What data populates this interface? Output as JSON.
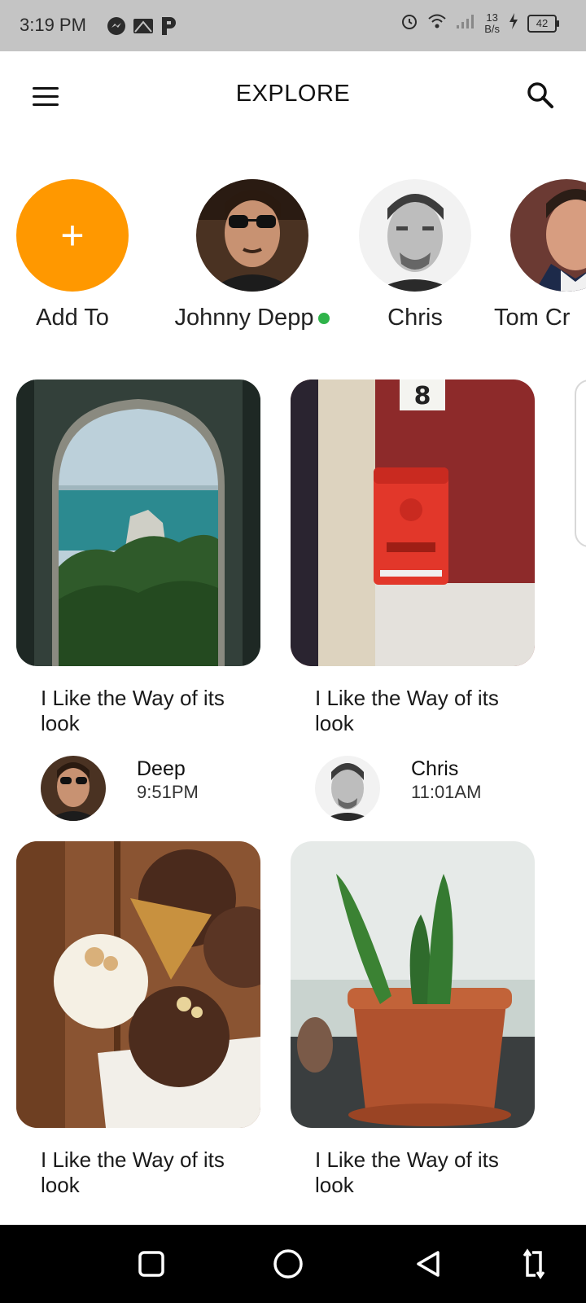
{
  "status_bar": {
    "time": "3:19 PM",
    "net_speed_value": "13",
    "net_speed_unit": "B/s",
    "battery": "42",
    "left_icons": [
      "messenger-icon",
      "email-icon",
      "pandora-icon"
    ],
    "right_icons": [
      "alarm-icon",
      "wifi-icon",
      "signal-icon",
      "charging-icon"
    ]
  },
  "app_bar": {
    "title": "EXPLORE",
    "menu_icon": "hamburger-menu-icon",
    "search_icon": "search-icon"
  },
  "stories": [
    {
      "name": "Add To",
      "type": "add",
      "icon": "plus-icon",
      "color": "#ff9800"
    },
    {
      "name": "Johnny Depp",
      "online": true,
      "online_color": "#2fb34a"
    },
    {
      "name": "Chris"
    },
    {
      "name": "Tom Cr"
    }
  ],
  "posts": [
    {
      "caption": "I Like the Way of its look",
      "author": "Deep",
      "time": "9:51PM",
      "image": "sea-arch-photo"
    },
    {
      "caption": "I Like the Way of its look",
      "author": "Chris",
      "time": "11:01AM",
      "image": "red-mailbox-photo"
    },
    {
      "caption": "I Like the Way of its look",
      "image": "ice-cream-photo"
    },
    {
      "caption": "I Like the Way of its look",
      "image": "cactus-photo"
    }
  ],
  "nav_bar": {
    "buttons": [
      "recents-square-icon",
      "home-circle-icon",
      "back-triangle-icon",
      "rotate-icon"
    ]
  }
}
